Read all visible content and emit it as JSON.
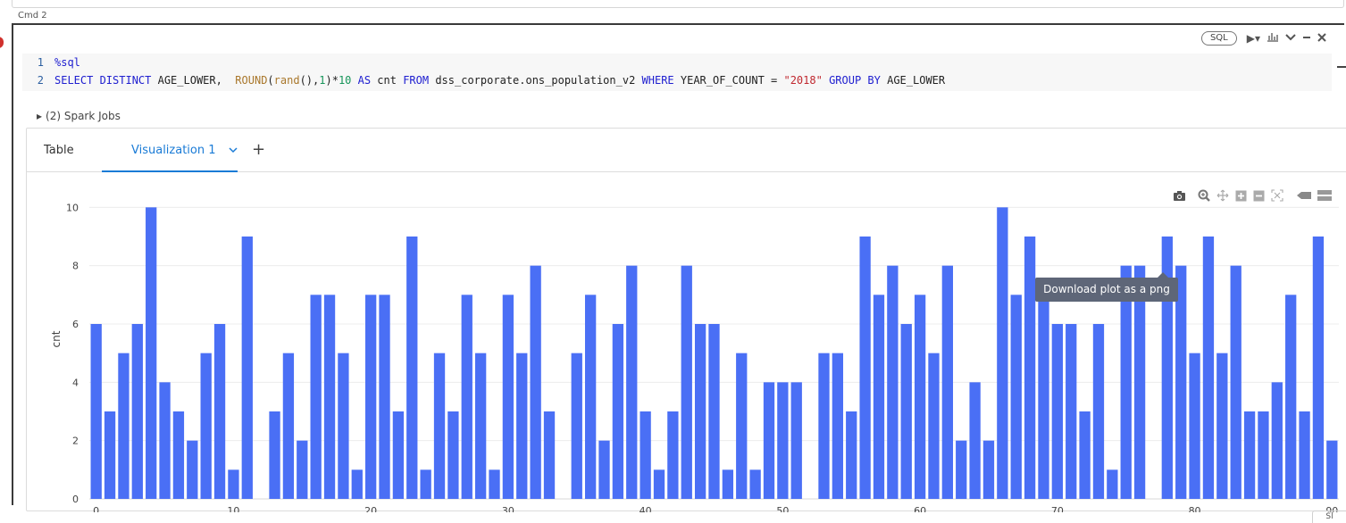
{
  "cell": {
    "label": "Cmd 2",
    "language": "SQL",
    "toolbar": {
      "run_icon": "run-dropdown-icon",
      "chart_icon": "chart-icon",
      "collapse_icon": "chevron-down-icon",
      "minimize_icon": "minimize-icon",
      "close_icon": "close-icon"
    },
    "code": {
      "line_numbers": [
        "1",
        "2"
      ],
      "line1": "%sql",
      "line2": {
        "t1": "SELECT DISTINCT",
        "t2": " AGE_LOWER,  ",
        "t3": "ROUND",
        "t4": "(",
        "t5": "rand",
        "t6": "(),",
        "t7": "1",
        "t8": ")*",
        "t9": "10",
        "t10": " ",
        "t11": "AS",
        "t12": " cnt ",
        "t13": "FROM",
        "t14": " dss_corporate.ons_population_v2 ",
        "t15": "WHERE",
        "t16": " YEAR_OF_COUNT = ",
        "t17": "\"2018\"",
        "t18": " ",
        "t19": "GROUP BY",
        "t20": " AGE_LOWER"
      }
    },
    "spark_jobs": "(2) Spark Jobs",
    "tabs": {
      "table": "Table",
      "visualization": "Visualization 1",
      "add": "+"
    },
    "tooltip": "Download plot as a png",
    "bottom_corner": "Sl"
  },
  "colors": {
    "bar": "#4a6ff5",
    "accent": "#1a7bd6",
    "tooltip_bg": "#5e6678"
  },
  "modebar_icons": [
    "camera-icon",
    "zoom-icon",
    "pan-icon",
    "zoom-in-icon",
    "zoom-out-icon",
    "autoscale-icon",
    "hover-closest-icon",
    "hover-compare-icon"
  ],
  "chart_data": {
    "type": "bar",
    "title": "",
    "xlabel": "",
    "ylabel": "cnt",
    "xlim": [
      -0.5,
      90.5
    ],
    "ylim": [
      0,
      10.5
    ],
    "xticks": [
      0,
      10,
      20,
      30,
      40,
      50,
      60,
      70,
      80,
      90
    ],
    "yticks": [
      0,
      2,
      4,
      6,
      8,
      10
    ],
    "grid": true,
    "series": [
      {
        "x": [
          0,
          1,
          2,
          3,
          4,
          5,
          6,
          7,
          8,
          9,
          10,
          11,
          12,
          13,
          14,
          15,
          16,
          17,
          18,
          19,
          20,
          21,
          22,
          23,
          24,
          25,
          26,
          27,
          28,
          29,
          30,
          31,
          32,
          33,
          34,
          35,
          36,
          37,
          38,
          39,
          40,
          41,
          42,
          43,
          44,
          45,
          46,
          47,
          48,
          49,
          50,
          51,
          52,
          53,
          54,
          55,
          56,
          57,
          58,
          59,
          60,
          61,
          62,
          63,
          64,
          65,
          66,
          67,
          68,
          69,
          70,
          71,
          72,
          73,
          74,
          75,
          76,
          77,
          78,
          79,
          80,
          81,
          82,
          83,
          84,
          85,
          86,
          87,
          88,
          89,
          90
        ],
        "values": [
          6,
          3,
          5,
          6,
          10,
          4,
          3,
          2,
          5,
          6,
          1,
          9,
          0,
          3,
          5,
          2,
          7,
          7,
          5,
          1,
          7,
          7,
          3,
          9,
          1,
          5,
          3,
          7,
          5,
          1,
          7,
          5,
          8,
          3,
          0,
          5,
          7,
          2,
          6,
          8,
          3,
          1,
          3,
          8,
          6,
          6,
          1,
          5,
          1,
          4,
          4,
          4,
          0,
          5,
          5,
          3,
          9,
          7,
          8,
          6,
          7,
          5,
          8,
          2,
          4,
          2,
          10,
          7,
          9,
          7,
          6,
          6,
          3,
          6,
          1,
          8,
          8,
          0,
          9,
          8,
          5,
          9,
          5,
          8,
          3,
          3,
          4,
          7,
          3,
          9,
          2
        ]
      }
    ]
  }
}
